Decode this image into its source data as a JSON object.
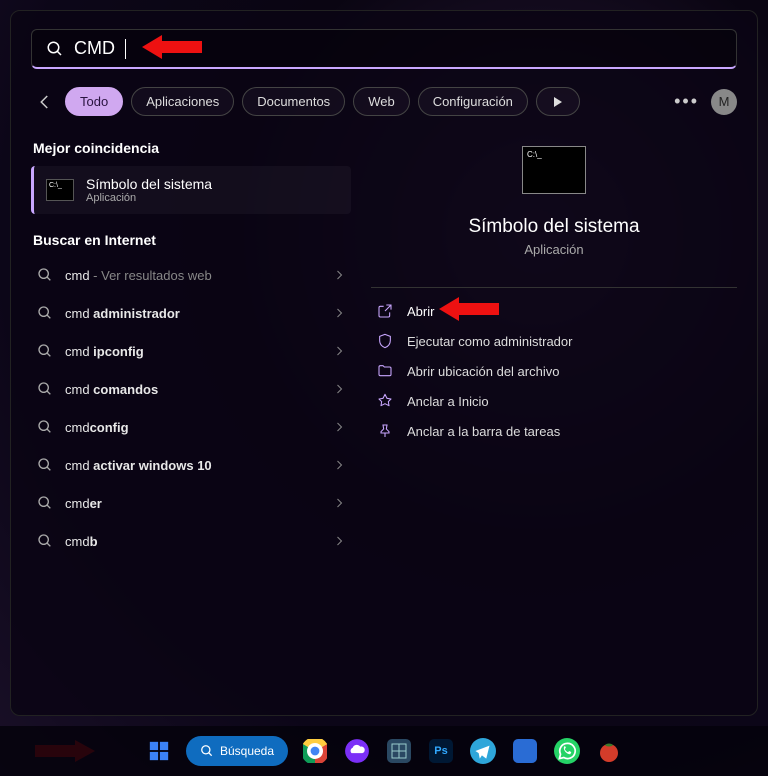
{
  "search": {
    "value": "CMD"
  },
  "filters": {
    "all": "Todo",
    "apps": "Aplicaciones",
    "docs": "Documentos",
    "web": "Web",
    "settings": "Configuración"
  },
  "avatarLetter": "M",
  "sections": {
    "bestMatch": "Mejor coincidencia",
    "internet": "Buscar en Internet"
  },
  "bestMatch": {
    "title": "Símbolo del sistema",
    "subtitle": "Aplicación"
  },
  "suggestions": [
    {
      "prefix": "cmd",
      "bold": "",
      "suffix": " - Ver resultados web",
      "mutedSuffix": true
    },
    {
      "prefix": "cmd ",
      "bold": "administrador",
      "suffix": ""
    },
    {
      "prefix": "cmd ",
      "bold": "ipconfig",
      "suffix": ""
    },
    {
      "prefix": "cmd ",
      "bold": "comandos",
      "suffix": ""
    },
    {
      "prefix": "cmd",
      "bold": "config",
      "suffix": ""
    },
    {
      "prefix": "cmd ",
      "bold": "activar windows 10",
      "suffix": ""
    },
    {
      "prefix": "cmd",
      "bold": "er",
      "suffix": ""
    },
    {
      "prefix": "cmd",
      "bold": "b",
      "suffix": ""
    }
  ],
  "detail": {
    "title": "Símbolo del sistema",
    "subtitle": "Aplicación"
  },
  "actions": {
    "open": "Abrir",
    "runAdmin": "Ejecutar como administrador",
    "openLocation": "Abrir ubicación del archivo",
    "pinStart": "Anclar a Inicio",
    "pinTaskbar": "Anclar a la barra de tareas"
  },
  "taskbar": {
    "searchLabel": "Búsqueda"
  },
  "colors": {
    "accent": "#c9a7ff",
    "annotation": "#e11"
  }
}
